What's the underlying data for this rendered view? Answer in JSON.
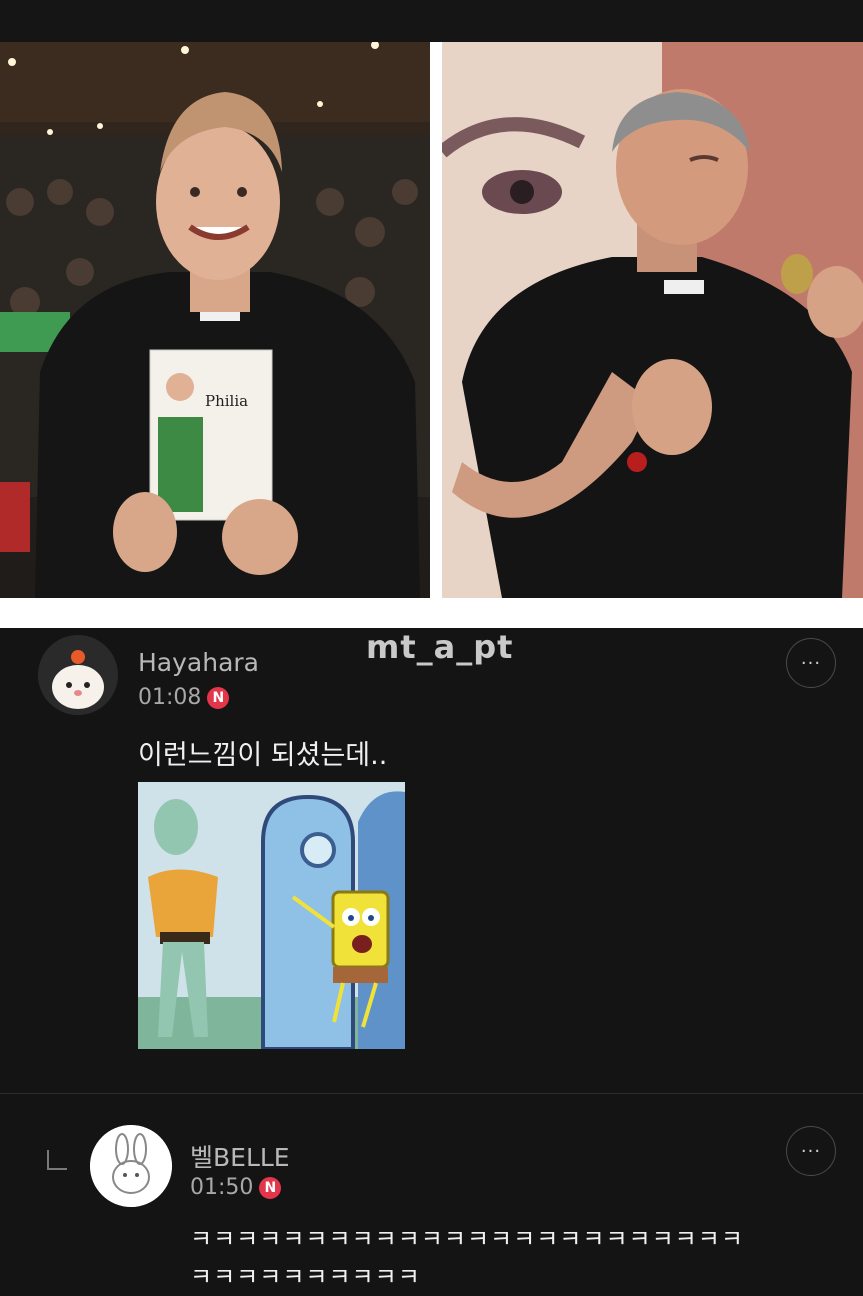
{
  "watermark": "mt_a_pt",
  "book_title": "Philia",
  "comments": [
    {
      "username": "Hayahara",
      "time": "01:08",
      "badge": "N",
      "text": "이런느낌이 되셨는데..",
      "more_label": "···"
    }
  ],
  "reply": {
    "username": "벨BELLE",
    "time": "01:50",
    "badge": "N",
    "text_line1": "ㅋㅋㅋㅋㅋㅋㅋㅋㅋㅋㅋㅋㅋㅋㅋㅋㅋㅋㅋㅋㅋㅋㅋㅋ",
    "text_line2": "ㅋㅋㅋㅋㅋㅋㅋㅋㅋㅋ",
    "more_label": "···"
  },
  "colors": {
    "background": "#141414",
    "badge": "#e4364a",
    "text": "#f0f0f0",
    "muted": "#a8a8a8"
  }
}
